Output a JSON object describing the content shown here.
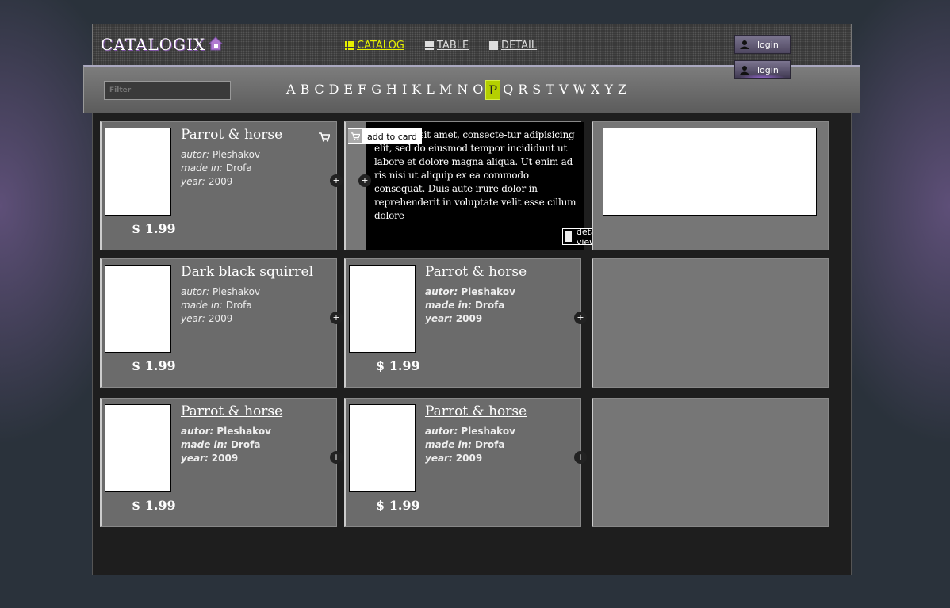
{
  "app": {
    "title": "CATALOGIX"
  },
  "nav": [
    {
      "label": "CATALOG",
      "icon": "grid-icon",
      "active": true
    },
    {
      "label": "TABLE",
      "icon": "list-icon"
    },
    {
      "label": "DETAIL",
      "icon": "square-icon"
    }
  ],
  "login": [
    "login",
    "login"
  ],
  "filter": {
    "placeholder": "Filter"
  },
  "letters": [
    "A",
    "B",
    "C",
    "D",
    "E",
    "F",
    "G",
    "H",
    "I",
    "K",
    "L",
    "M",
    "N",
    "O",
    "P",
    "Q",
    "R",
    "S",
    "T",
    "V",
    "W",
    "X",
    "Y",
    "Z"
  ],
  "selected_letter": "P",
  "accent": "#b5d000",
  "labels": {
    "autor": "autor:",
    "made": "made in:",
    "year": "year:"
  },
  "cards": [
    {
      "title": "Parrot & horse",
      "autor": "Pleshakov",
      "made": "Drofa",
      "year": "2009",
      "price": "$ 1.99"
    },
    {
      "hover_text": "um dolor sit amet, consecte-tur adipisicing elit, sed do eiusmod tempor incididunt ut labore et dolore magna aliqua. Ut enim ad ris nisi ut aliquip ex ea commodo consequat. Duis aute irure dolor in reprehenderit in voluptate velit esse cillum dolore",
      "add_label": "add to card",
      "detail_label": "detail view"
    },
    {
      "title": "Dark black squirrel",
      "autor": "Pleshakov",
      "made": "Drofa",
      "year": "2009",
      "price": "$ 1.99"
    },
    {
      "title": "Parrot & horse",
      "autor": "Pleshakov",
      "made": "Drofa",
      "year": "2009",
      "price": "$ 1.99"
    },
    {
      "title": "Parrot & horse",
      "autor": "Pleshakov",
      "made": "Drofa",
      "year": "2009",
      "price": "$ 1.99"
    },
    {
      "title": "Parrot & horse",
      "autor": "Pleshakov",
      "made": "Drofa",
      "year": "2009",
      "price": "$ 1.99"
    }
  ]
}
